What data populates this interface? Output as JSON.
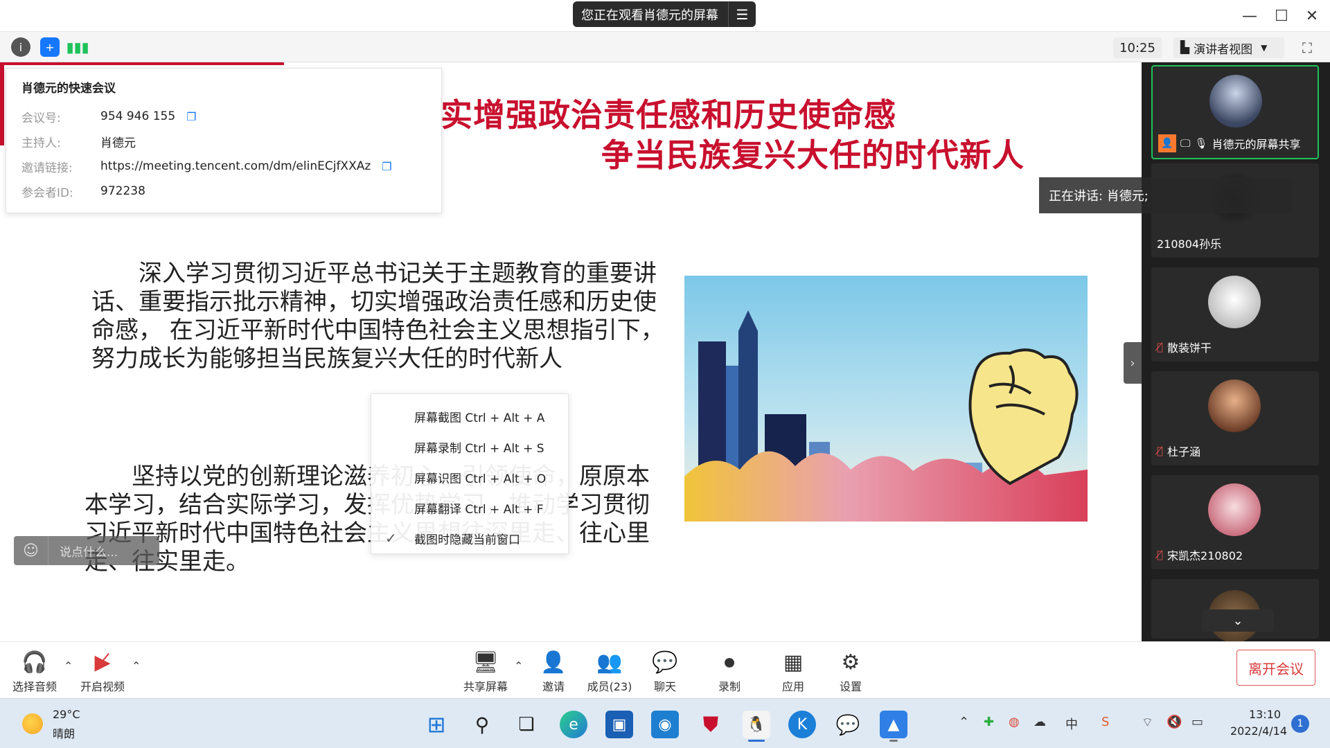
{
  "title_bar": {
    "viewing_banner": "您正在观看肖德元的屏幕",
    "banner_menu_icon": "menu-icon"
  },
  "toolbar": {
    "clock": "10:25",
    "speaker_view_label": "演讲者视图"
  },
  "meeting_info": {
    "title": "肖德元的快速会议",
    "rows": [
      {
        "key": "会议号:",
        "value": "954 946 155",
        "copyable": true
      },
      {
        "key": "主持人:",
        "value": "肖德元",
        "copyable": false
      },
      {
        "key": "邀请链接:",
        "value": "https://meeting.tencent.com/dm/elinECjfXXAz",
        "copyable": true
      },
      {
        "key": "参会者ID:",
        "value": "972238",
        "copyable": false
      }
    ]
  },
  "slide": {
    "title_line1": "实增强政治责任感和历史使命感",
    "title_line2": "争当民族复兴大任的时代新人",
    "paragraph1": "深入学习贯彻习近平总书记关于主题教育的重要讲话、重要指示批示精神，切实增强政治责任感和历史使命感， 在习近平新时代中国特色社会主义思想指引下，努力成长为能够担当民族复兴大任的时代新人",
    "paragraph2": "坚持以党的创新理论滋养初心、引领使命，原原本本学习，结合实际学习，发挥优势学习，推动学习贯彻习近平新时代中国特色社会主义思想往深里走、往心里走、往实里走。"
  },
  "context_menu": {
    "items": [
      {
        "label": "屏幕截图 Ctrl + Alt + A",
        "checked": false
      },
      {
        "label": "屏幕录制 Ctrl + Alt + S",
        "checked": false
      },
      {
        "label": "屏幕识图 Ctrl + Alt + O",
        "checked": false
      },
      {
        "label": "屏幕翻译 Ctrl + Alt + F",
        "checked": false
      },
      {
        "label": "截图时隐藏当前窗口",
        "checked": true
      }
    ]
  },
  "chat": {
    "placeholder": "说点什么..."
  },
  "speaking": {
    "text": "正在讲话: 肖德元;"
  },
  "participants": [
    {
      "name": "肖德元的屏幕共享",
      "muted": false,
      "active": true
    },
    {
      "name": "210804孙乐",
      "muted": false,
      "active": false
    },
    {
      "name": "散装饼干",
      "muted": true,
      "active": false
    },
    {
      "name": "杜子涵",
      "muted": true,
      "active": false
    },
    {
      "name": "宋凯杰210802",
      "muted": true,
      "active": false
    }
  ],
  "controls": {
    "audio": "选择音频",
    "video": "开启视频",
    "share": "共享屏幕",
    "invite": "邀请",
    "members": "成员(23)",
    "chat": "聊天",
    "record": "录制",
    "apps": "应用",
    "settings": "设置",
    "leave": "离开会议"
  },
  "taskbar": {
    "temperature": "29°C",
    "weather": "晴朗",
    "time": "13:10",
    "date": "2022/4/14",
    "notification_count": "1",
    "ime_label": "中"
  },
  "colors": {
    "accent_red": "#c8102e",
    "active_green": "#1ec25a",
    "link_blue": "#1677ff"
  }
}
